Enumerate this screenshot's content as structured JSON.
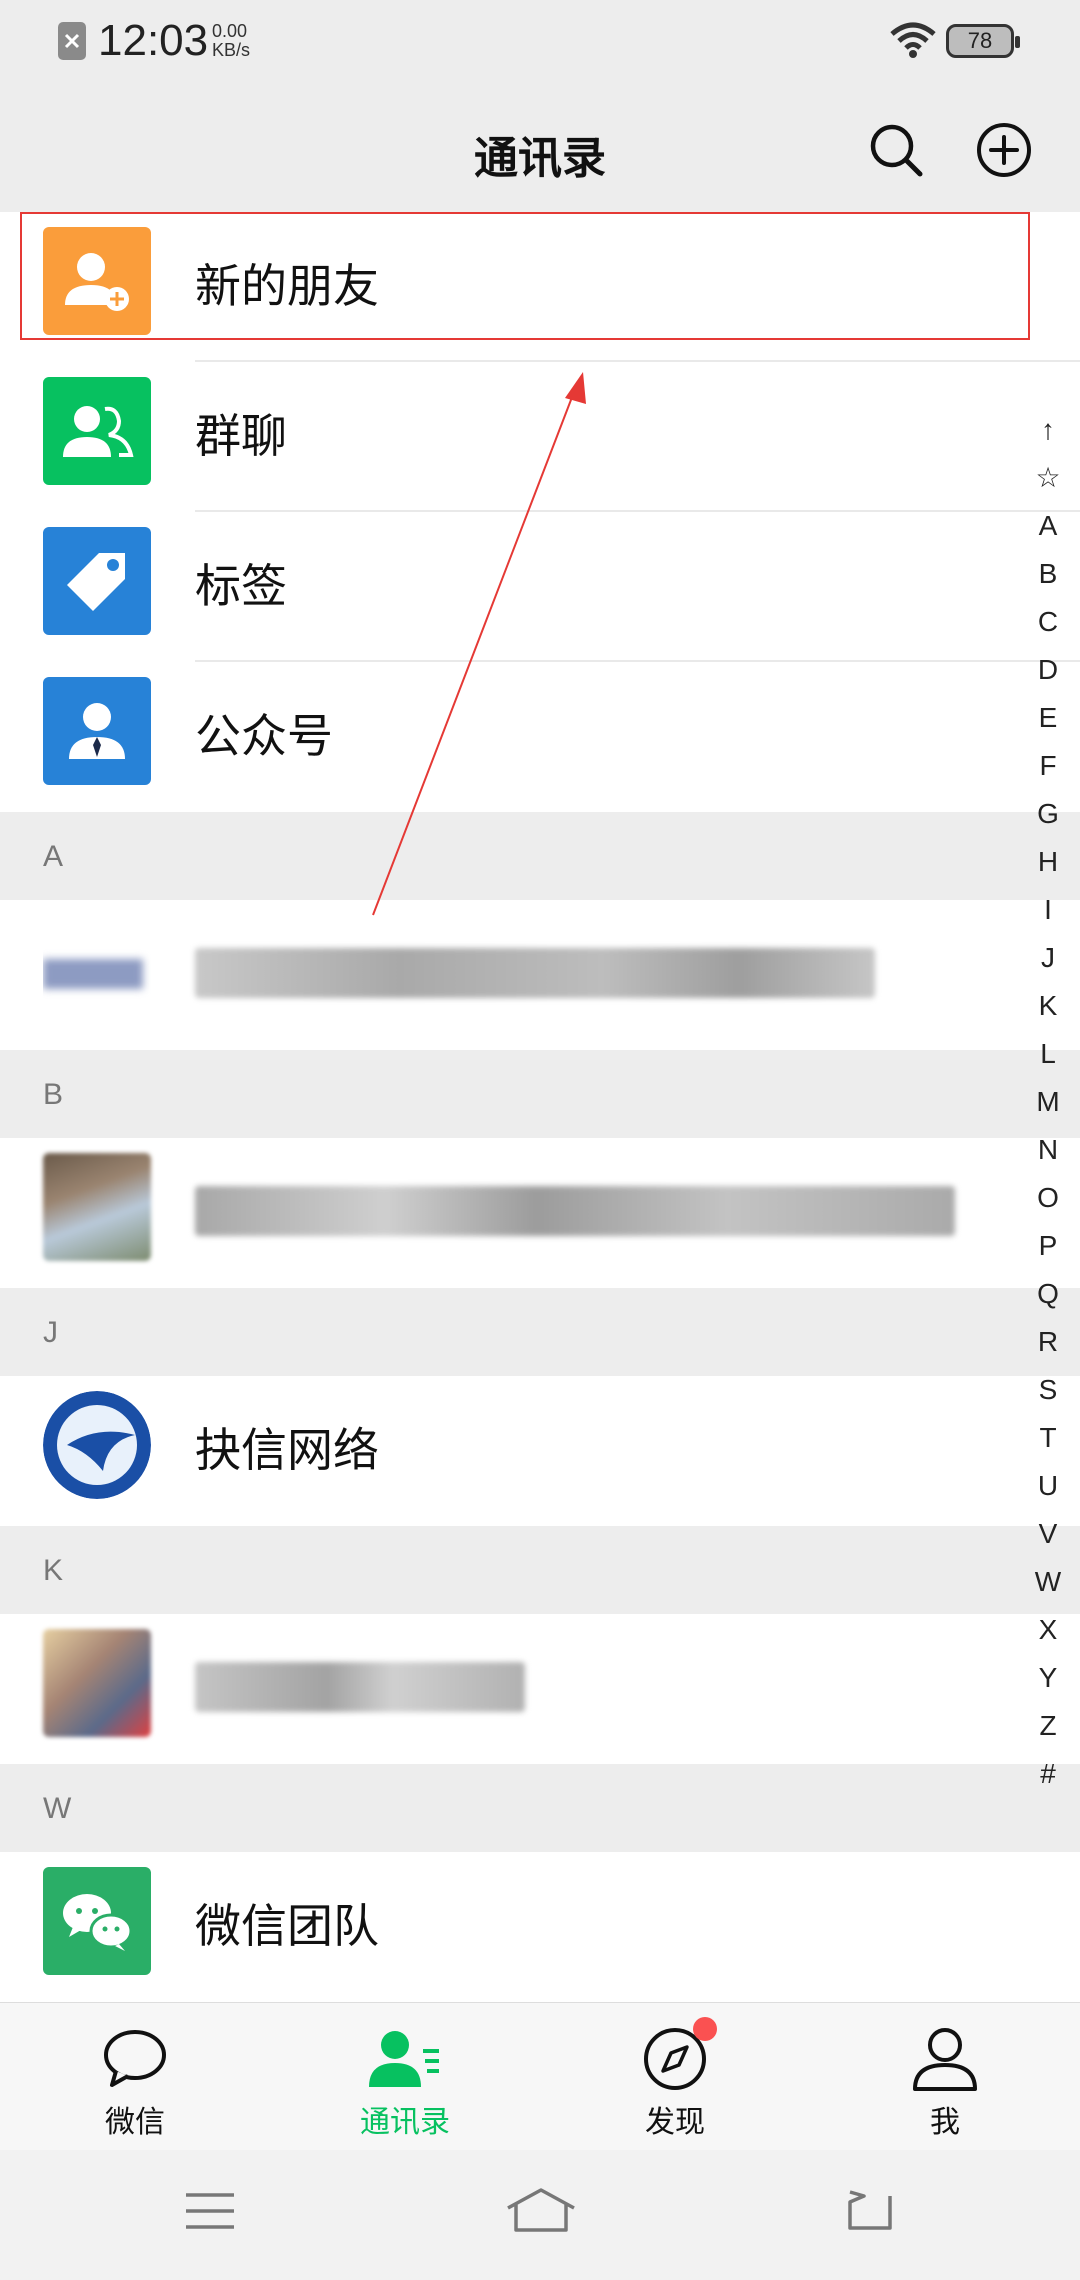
{
  "status_bar": {
    "time": "12:03",
    "net_speed_value": "0.00",
    "net_speed_unit": "KB/s",
    "battery": "78"
  },
  "header": {
    "title": "通讯录"
  },
  "menu_items": [
    {
      "label": "新的朋友",
      "icon": "add-friend-icon",
      "color": "#fa9d3b"
    },
    {
      "label": "群聊",
      "icon": "group-icon",
      "color": "#07c160"
    },
    {
      "label": "标签",
      "icon": "tag-icon",
      "color": "#2782d7"
    },
    {
      "label": "公众号",
      "icon": "official-account-icon",
      "color": "#2782d7"
    }
  ],
  "sections": [
    {
      "letter": "A"
    },
    {
      "letter": "B"
    },
    {
      "letter": "J",
      "contact": "抉信网络"
    },
    {
      "letter": "K"
    },
    {
      "letter": "W",
      "contact": "微信团队"
    }
  ],
  "index_letters": [
    "↑",
    "☆",
    "A",
    "B",
    "C",
    "D",
    "E",
    "F",
    "G",
    "H",
    "I",
    "J",
    "K",
    "L",
    "M",
    "N",
    "O",
    "P",
    "Q",
    "R",
    "S",
    "T",
    "U",
    "V",
    "W",
    "X",
    "Y",
    "Z",
    "#"
  ],
  "tabs": [
    {
      "label": "微信",
      "icon": "chat-bubble-icon"
    },
    {
      "label": "通讯录",
      "icon": "contacts-icon",
      "active": true
    },
    {
      "label": "发现",
      "icon": "compass-icon",
      "badge": true
    },
    {
      "label": "我",
      "icon": "person-icon"
    }
  ],
  "colors": {
    "accent": "#07c160",
    "highlight": "#e53935",
    "badge": "#fa5151"
  }
}
